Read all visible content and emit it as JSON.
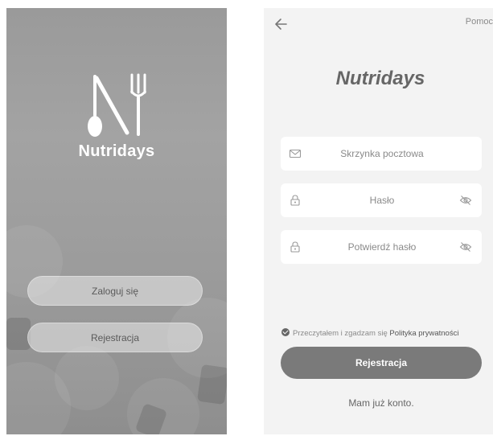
{
  "welcome": {
    "brand": "Nutridays",
    "login_label": "Zaloguj się",
    "register_label": "Rejestracja"
  },
  "register": {
    "help_label": "Pomoc",
    "brand": "Nutridays",
    "email_placeholder": "Skrzynka pocztowa",
    "password_placeholder": "Hasło",
    "confirm_placeholder": "Potwierdź hasło",
    "consent_text": "Przeczytałem i zgadzam się",
    "policy_link": "Polityka prywatności",
    "register_button": "Rejestracja",
    "have_account": "Mam już konto."
  },
  "icons": {
    "back": "arrow-left-icon",
    "mail": "mail-icon",
    "lock": "lock-icon",
    "eye": "eye-off-icon"
  },
  "colors": {
    "primary_button": "#7a7a7a",
    "field_background": "#ffffff",
    "screen_background": "#f3f3f3"
  }
}
